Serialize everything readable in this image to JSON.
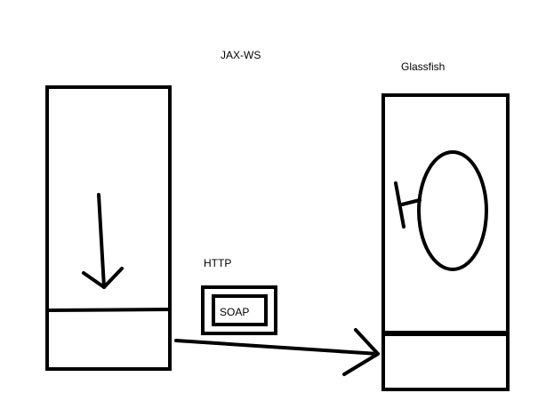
{
  "labels": {
    "top_label": "JAX-WS",
    "server_label": "Glassfish",
    "protocol_label": "HTTP",
    "envelope_label": "SOAP"
  },
  "colors": {
    "stroke": "#000000",
    "background": "#ffffff"
  }
}
